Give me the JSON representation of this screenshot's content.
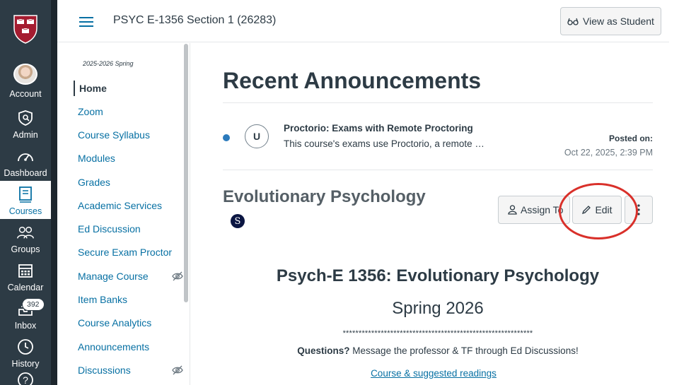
{
  "global_nav": {
    "items": [
      {
        "label": "Account",
        "icon": "avatar"
      },
      {
        "label": "Admin",
        "icon": "admin-shield-icon"
      },
      {
        "label": "Dashboard",
        "icon": "dashboard-gauge-icon"
      },
      {
        "label": "Courses",
        "icon": "courses-book-icon",
        "active": true
      },
      {
        "label": "Groups",
        "icon": "groups-icon"
      },
      {
        "label": "Calendar",
        "icon": "calendar-icon"
      },
      {
        "label": "Inbox",
        "icon": "inbox-icon",
        "badge": "392"
      },
      {
        "label": "History",
        "icon": "history-clock-icon"
      },
      {
        "label": "Help",
        "icon": "help-icon"
      }
    ],
    "active_color": "#0770a3",
    "background": "#2d3b45"
  },
  "header": {
    "course_title": "PSYC E-1356 Section 1 (26283)",
    "view_as_student": "View as Student"
  },
  "course_nav": {
    "term": "2025-2026 Spring",
    "items": [
      {
        "label": "Home",
        "active": true
      },
      {
        "label": "Zoom"
      },
      {
        "label": "Course Syllabus"
      },
      {
        "label": "Modules"
      },
      {
        "label": "Grades"
      },
      {
        "label": "Academic Services"
      },
      {
        "label": "Ed Discussion"
      },
      {
        "label": "Secure Exam Proctor"
      },
      {
        "label": "Manage Course",
        "hidden": true
      },
      {
        "label": "Item Banks"
      },
      {
        "label": "Course Analytics"
      },
      {
        "label": "Announcements"
      },
      {
        "label": "Discussions",
        "hidden": true
      }
    ]
  },
  "main": {
    "recent_title": "Recent Announcements",
    "announcement": {
      "avatar_letter": "U",
      "title": "Proctorio: Exams with Remote Proctoring",
      "snippet": "This course's exams use Proctorio, a remote …",
      "posted_label": "Posted on:",
      "posted_date": "Oct 22, 2025, 2:39 PM"
    },
    "page_title": "Evolutionary Psychology",
    "s_badge": "S",
    "buttons": {
      "assign": "Assign To",
      "edit": "Edit"
    },
    "content": {
      "heading": "Psych-E 1356: Evolutionary Psychology",
      "subheading": "Spring 2026",
      "divider": "************************************************************",
      "questions_bold": "Questions?",
      "questions_rest": " Message the professor & TF through Ed Discussions!",
      "readings_link": "Course & suggested readings"
    },
    "highlight_color": "#d9302a"
  }
}
